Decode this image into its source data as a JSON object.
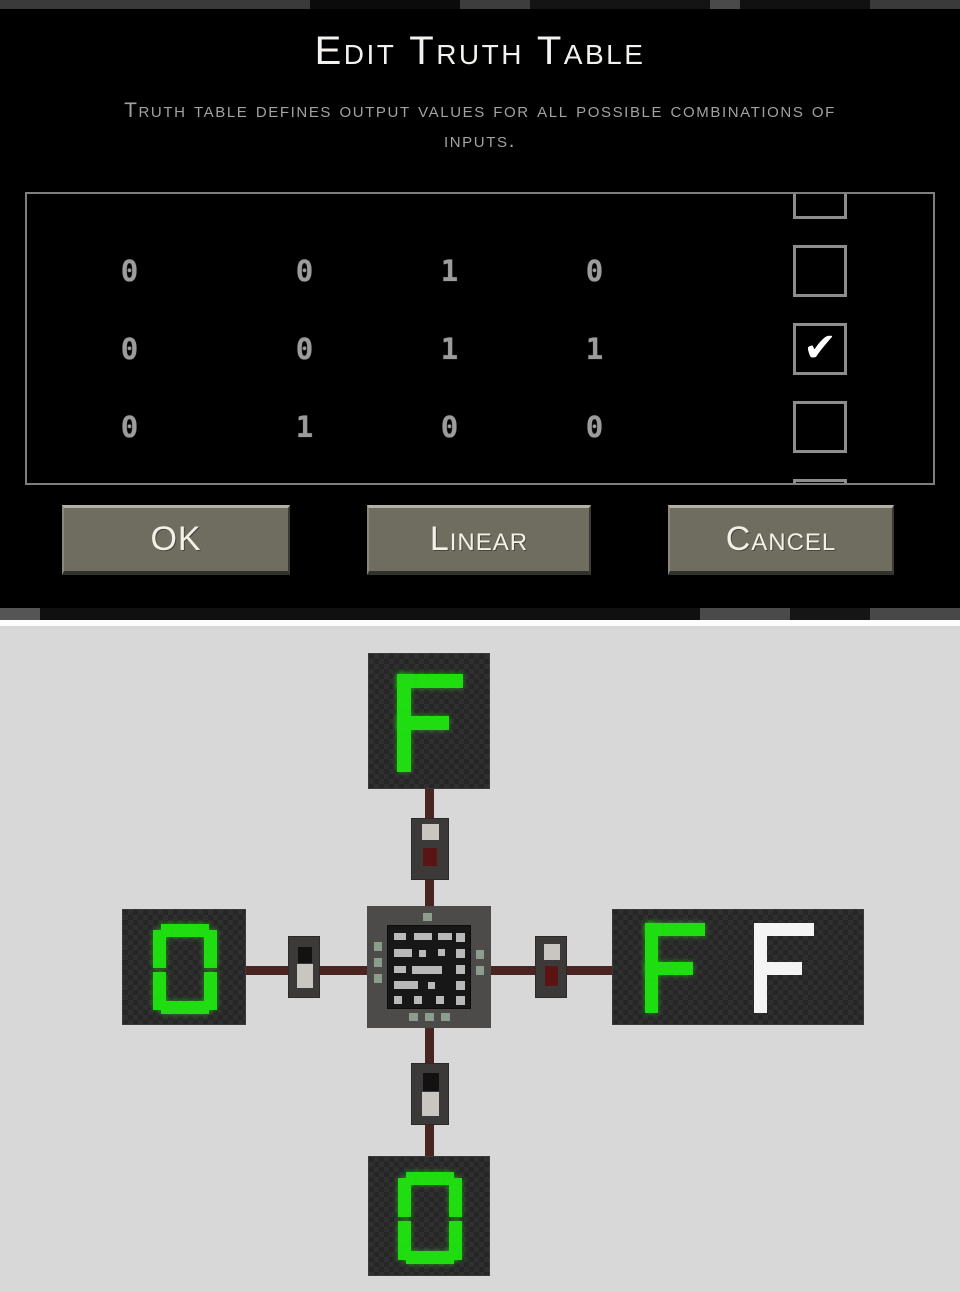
{
  "dialog": {
    "title": "Edit Truth Table",
    "subtitle": "Truth table defines output values for all possible combinations of inputs.",
    "columns": [
      "in0",
      "in1",
      "in2",
      "in3"
    ],
    "rows": [
      {
        "inputs": [
          "0",
          "0",
          "1",
          "0"
        ],
        "output": false,
        "partial": false
      },
      {
        "inputs": [
          "0",
          "0",
          "1",
          "1"
        ],
        "output": true,
        "partial": false
      },
      {
        "inputs": [
          "0",
          "1",
          "0",
          "0"
        ],
        "output": false,
        "partial": false
      }
    ],
    "check_glyph": "✔",
    "buttons": {
      "ok": "OK",
      "linear": "Linear",
      "cancel": "Cancel"
    }
  },
  "canvas": {
    "background_color": "#d8d8d8",
    "wire_color": "#4a2420",
    "segment_on_color": "#1fdd10",
    "segment_white_color": "#f4f4f4",
    "displays": [
      {
        "id": "top-display",
        "value": "F",
        "color": "green"
      },
      {
        "id": "left-display",
        "value": "0",
        "color": "green"
      },
      {
        "id": "right-display",
        "value": "FF",
        "color": "green+white"
      },
      {
        "id": "bottom-display",
        "value": "0",
        "color": "green"
      }
    ],
    "components": [
      {
        "id": "chip",
        "label": "logic-ic"
      },
      {
        "id": "switch-top",
        "state": "on"
      },
      {
        "id": "switch-right",
        "state": "on"
      },
      {
        "id": "switch-left",
        "state": "off"
      },
      {
        "id": "switch-bottom",
        "state": "off"
      }
    ]
  }
}
